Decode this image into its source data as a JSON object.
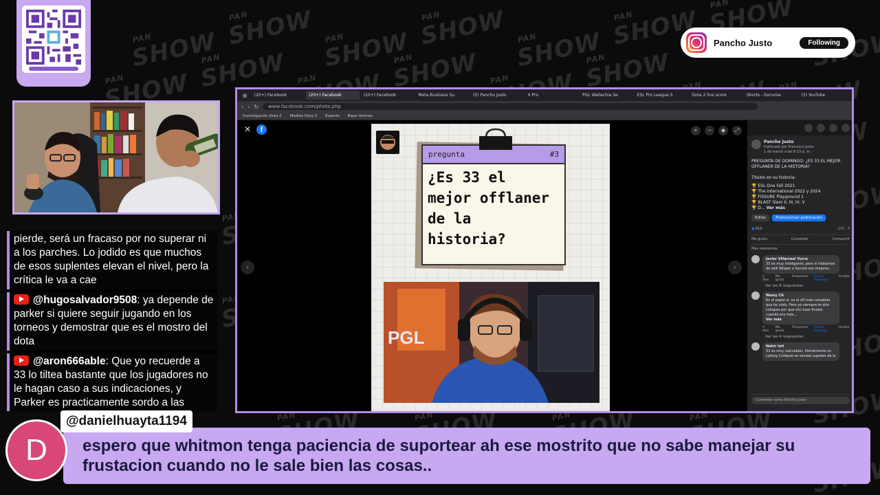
{
  "watermark": {
    "brand": "PAN SHOW",
    "word_top": "PAN",
    "word_main": "SHOW"
  },
  "instagram": {
    "name": "Pancho Justo",
    "follow_label": "Following"
  },
  "browser": {
    "tabs": [
      "(20+) Facebook",
      "(20+) Facebook",
      "(20+) Facebook",
      "Meta Business Su",
      "(5) Pancho Justo",
      "X Pro",
      "PGL Wallachia Se",
      "ESL Pro League S",
      "Dota 2 live score",
      "Shorts - Docume",
      "(3) YouTube"
    ],
    "url": "www.facebook.com/photo.php",
    "bookmarks": [
      "Investigación Dota 2",
      "Medios Dota 2",
      "Esports",
      "Bajar Animes"
    ]
  },
  "post_image": {
    "tag": "pregunta",
    "number": "#3",
    "question_lines": [
      "¿Es 33 el",
      "mejor offlaner",
      "de la",
      "historia?"
    ]
  },
  "sidebar": {
    "author": "Pancho Justo",
    "subtitle": "Publicado por Francisco Justo",
    "date": "1 de marzo a las 6:15 p. m. ·",
    "text": "PREGUNTA DE DOMINGO: ¿ES 33 EL MEJOR OFFLANER DE LA HISTORIA?",
    "titles_heading": "Títulos en su historia:",
    "titles": [
      "🏆 ESL One Fall 2021",
      "🏆 The International 2022 y 2024",
      "🏆 FISSURE Playground 1",
      "🏆 BLAST Slam II, III, IV, V",
      "🏆 D..."
    ],
    "see_more": "Ver más",
    "edit_label": "Editar",
    "promote_label": "Promocionar publicación",
    "reactions": "610",
    "comment_count": "172",
    "share_count": "3",
    "actions": [
      "Me gusta",
      "Comentar",
      "Compartir"
    ],
    "filter": "Más relevantes",
    "comments": [
      {
        "name": "Javier Villarreal Yucra",
        "text": "33 es muy inteligente, pero si hablamos de skill Wisper o Sacred son mejores.",
        "age": "3 días",
        "replies": "Ver las 8 respuestas"
      },
      {
        "name": "Nassy CA",
        "text": "En el papel sí, es el off más completo que he visto. Pero yo siempre te diré collapse por que viví esas finales cuando era más...",
        "more": "Ver más",
        "age": "3 días",
        "replies": "Ver las 4 respuestas"
      },
      {
        "name": "Nahir Ieti",
        "text": "33 es muy calculador, literalmente un cyborg Collapse se sacaba jugadas de la"
      }
    ],
    "comment_actions": [
      "Me gusta",
      "Responder",
      "Enviar mensaje",
      "Ocultar"
    ],
    "comment_placeholder": "Comentar como Pancho Justo"
  },
  "chat": [
    {
      "user": "",
      "text": "pierde, será un fracaso por no superar ni a los parches. Lo jodido es que muchos de esos suplentes elevan el nivel, pero la crítica le va a cae"
    },
    {
      "user": "@hugosalvador9508",
      "text": ": ya depende de parker si quiere seguir jugando en los torneos y demostrar que es el mostro del dota"
    },
    {
      "user": "@aron666able",
      "text": ": Que yo recuerde a 33 lo tiltea bastante que los jugadores no le hagan caso a sus indicaciones, y Parker es practicamente sordo a las ordenes de otros"
    }
  ],
  "highlight": {
    "avatar_letter": "D",
    "user": "@danielhuayta1194",
    "message": "espero que whitmon tenga paciencia de suportear ah ese mostrito que no sabe manejar su frustacion cuando no le sale bien las cosas.."
  },
  "colors": {
    "accent": "#c8a8f0",
    "border": "#b48be8",
    "youtube": "#e62117",
    "facebook": "#1877f2",
    "avatar": "#d9477a"
  }
}
